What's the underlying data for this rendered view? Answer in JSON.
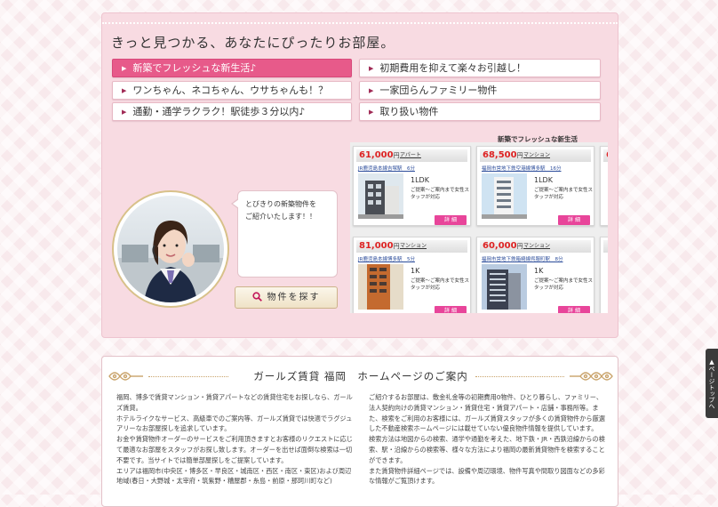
{
  "headline": "きっと見つかる、あなたにぴったりお部屋。",
  "menu": [
    {
      "label": "新築でフレッシュな新生活♪",
      "active": true
    },
    {
      "label": "初期費用を抑えて楽々お引越し！",
      "active": false
    },
    {
      "label": "ワンちゃん、ネコちゃん、ウサちゃんも！？",
      "active": false
    },
    {
      "label": "一家団らんファミリー物件",
      "active": false
    },
    {
      "label": "通勤・通学ラクラク！駅徒歩３分以内♪",
      "active": false
    },
    {
      "label": "取り扱い物件",
      "active": false
    }
  ],
  "bubble": "とびきりの新築物件を\nご紹介いたします！！",
  "search_button": "物件を探す",
  "featured_title": "新築でフレッシュな新生活",
  "cards": [
    {
      "price": "61,000",
      "yen": "円",
      "type": "アパート",
      "station": "JR鹿児島本線吉塚駅　6分",
      "layout": "1LDK",
      "note": "ご提案〜ご案内まで女性スタッフが対応",
      "detail": "詳 細"
    },
    {
      "price": "68,500",
      "yen": "円",
      "type": "マンション",
      "station": "福岡市営地下鉄空港線博多駅　16分",
      "layout": "1LDK",
      "note": "ご提案〜ご案内まで女性スタッフが対応",
      "detail": "詳 細"
    },
    {
      "price": "81,000",
      "yen": "円",
      "type": "マンション",
      "station": "JR鹿児島本線博多駅　5分",
      "layout": "1K",
      "note": "ご提案〜ご案内まで女性スタッフが対応",
      "detail": "詳 細"
    },
    {
      "price": "60,000",
      "yen": "円",
      "type": "マンション",
      "station": "福岡市営地下鉄箱崎線呉服町駅　8分",
      "layout": "1K",
      "note": "ご提案〜ご案内まで女性スタッフが対応",
      "detail": "詳 細"
    }
  ],
  "partial_price_digit": "6",
  "section_title": "ガールズ賃貸 福岡　ホームページのご案内",
  "left_text": "福岡、博多で賃貸マンション・賃貸アパートなどの賃貸住宅をお探しなら、ガールズ賃貸。\nホテルライクなサービス、高級車でのご案内等、ガールズ賃貸では快適でラグジュアリーなお部屋探しを追求しています。\nお金や賃貸物件オーダーのサービスをご利用頂きますとお客様のリクエストに応じて最適なお部屋をスタッフがお探し致します。オーダーを出せば面倒な検索は一切不要です。当サイトでは簡単部屋探しをご提案しています。\nエリアは福岡市(中央区・博多区・早良区・城南区・西区・南区・東区)および周辺地域(春日・大野城・太宰府・筑紫野・糟屋郡・糸島・前原・那珂川町など)",
  "right_text": "ご紹介するお部屋は、敷金礼金等の初期費用0物件、ひとり暮らし、ファミリー、法人契約向けの賃貸マンション・賃貸住宅・賃貸アパート・店舗・事務所等。また、検索をご利用のお客様には、ガールズ賃貸スタッフが多くの賃貸物件から厳選した不動産検索ホームページには載せていない優良物件情報を提供しています。\n検索方法は地図からの検索、通学や通勤を考えた、地下鉄・JR・西鉄沿線からの検索、駅・沿線からの検索等、様々な方法により福岡の最新賃貸物件を検索することができます。\nまた賃貸物件詳細ページでは、設備や周辺環境、物件写真や間取り図面などの多彩な情報がご覧頂けます。",
  "pagetop": "ページトップへ",
  "colors": {
    "accent": "#e75a8a",
    "price": "#dd2222",
    "detail": "#e8459a",
    "panel": "#f8dbe2"
  }
}
